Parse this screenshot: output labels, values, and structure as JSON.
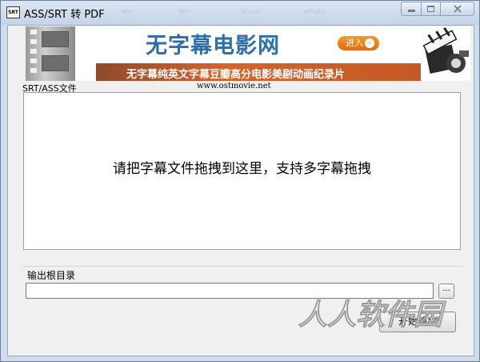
{
  "window": {
    "title": "ASS/SRT 转 PDF",
    "icon_label": "SRT",
    "ghost_title": "Win",
    "ghost_title_2": "Vcout",
    "ghost_title_3": "ePhoto",
    "controls": [
      "minimize",
      "maximize",
      "close"
    ]
  },
  "banner": {
    "brand": "无字幕电影网",
    "enter_label": "进入",
    "enter_arrow": "›",
    "tagline": "无字幕纯英文字幕豆瓣高分电影美剧动画纪录片",
    "site": "www.ostmovie.net"
  },
  "files": {
    "group_label": "SRT/ASS文件",
    "drop_hint": "请把字幕文件拖拽到这里，支持多字幕拖拽"
  },
  "output": {
    "group_label": "输出根目录",
    "path_value": "",
    "browse_label": "...",
    "start_label": "开始输出"
  },
  "watermark": {
    "text": "人人软件园"
  }
}
